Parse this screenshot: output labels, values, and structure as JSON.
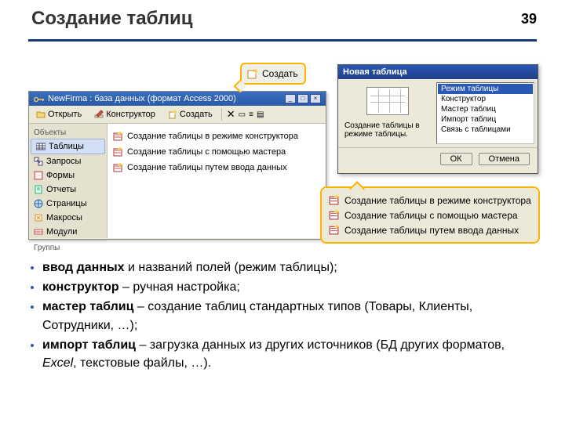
{
  "page": {
    "title": "Создание таблиц",
    "number": "39"
  },
  "create_button": {
    "label": "Создать"
  },
  "db_window": {
    "title": "NewFirma : база данных (формат Access 2000)",
    "toolbar": {
      "open": "Открыть",
      "constructor": "Конструктор",
      "create": "Создать"
    },
    "sidebar": {
      "header": "Объекты",
      "items": [
        {
          "label": "Таблицы"
        },
        {
          "label": "Запросы"
        },
        {
          "label": "Формы"
        },
        {
          "label": "Отчеты"
        },
        {
          "label": "Страницы"
        },
        {
          "label": "Макросы"
        },
        {
          "label": "Модули"
        }
      ],
      "groups": "Группы"
    },
    "list": [
      {
        "label": "Создание таблицы в режиме конструктора"
      },
      {
        "label": "Создание таблицы с помощью мастера"
      },
      {
        "label": "Создание таблицы путем ввода данных"
      }
    ]
  },
  "dialog": {
    "title": "Новая таблица",
    "desc": "Создание таблицы в режиме таблицы.",
    "options": [
      "Режим таблицы",
      "Конструктор",
      "Мастер таблиц",
      "Импорт таблиц",
      "Связь с таблицами"
    ],
    "ok": "ОК",
    "cancel": "Отмена"
  },
  "callout_list": [
    "Создание таблицы в режиме конструктора",
    "Создание таблицы с помощью мастера",
    "Создание таблицы путем ввода данных"
  ],
  "bullets": {
    "b1_strong": "ввод данных",
    "b1_rest": " и названий полей (режим таблицы);",
    "b2_strong": "конструктор",
    "b2_rest": " – ручная настройка;",
    "b3_strong": "мастер таблиц",
    "b3_rest": " – создание таблиц стандартных типов (Товары, Клиенты, Сотрудники, …);",
    "b4_strong": "импорт таблиц",
    "b4_rest_a": " – загрузка данных из других источников (БД других форматов, ",
    "b4_em": "Excel",
    "b4_rest_b": ", текстовые файлы, …)."
  }
}
